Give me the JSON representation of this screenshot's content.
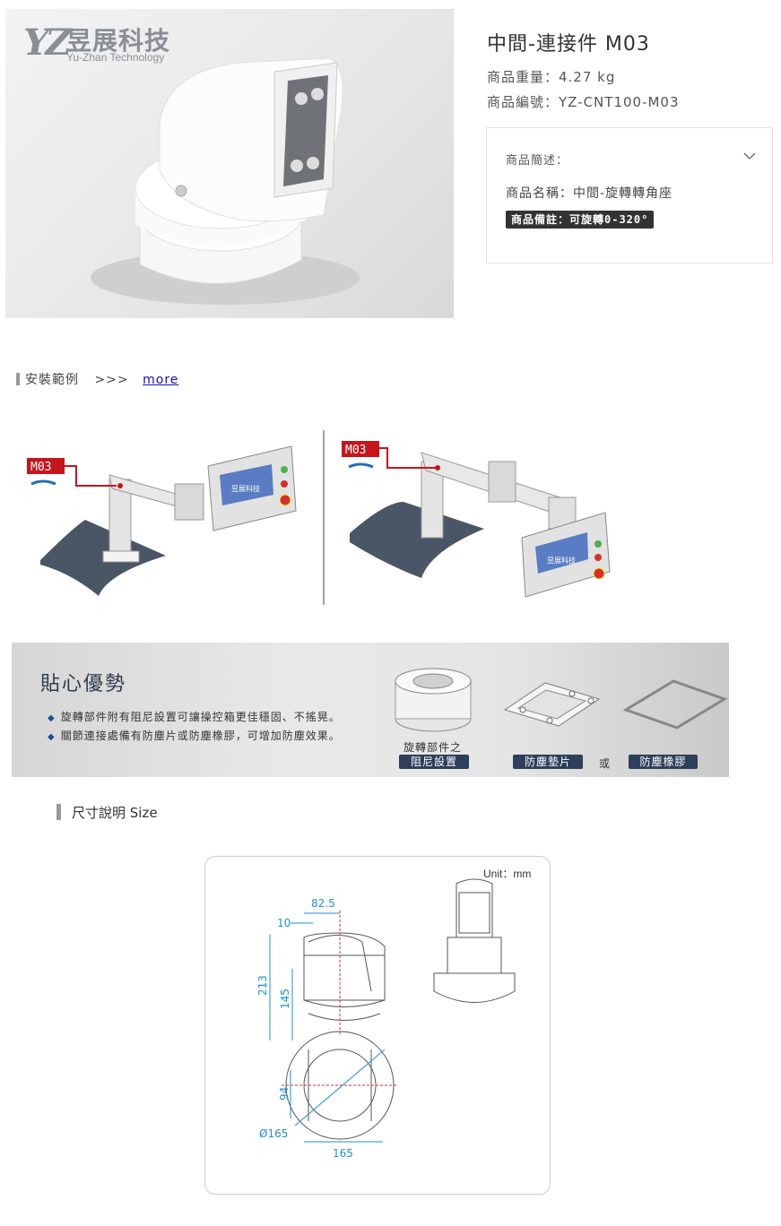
{
  "brand": {
    "mark": "YZ",
    "name_cn": "昱展科技",
    "name_en": "Yu-Zhan Technology"
  },
  "product": {
    "title": "中間-連接件 M03",
    "weight": "商品重量：4.27 kg",
    "sku": "商品編號：YZ-CNT100-M03",
    "desc_label": "商品簡述：",
    "desc_name": "商品名稱：中間-旋轉轉角座",
    "desc_note": "商品備註：可旋轉0-320°"
  },
  "install": {
    "label": "安裝範例",
    "arrows": ">>>",
    "link": "more"
  },
  "examples": {
    "tag": "M03",
    "screen_text": "昱展科技"
  },
  "advantages": {
    "title": "貼心優勢",
    "items": [
      "旋轉部件附有阻尼設置可讓操控箱更佳穩固、不搖晃。",
      "關節連接處備有防塵片或防塵橡膠，可增加防塵效果。"
    ],
    "part1_caption": "旋轉部件之",
    "part1_tag": "阻尼設置",
    "part2_tag": "防塵墊片",
    "or": "或",
    "part3_tag": "防塵橡膠"
  },
  "size": {
    "heading": "尺寸說明 Size",
    "unit": "Unit：mm",
    "dims": {
      "d1": "82.5",
      "d2": "10",
      "d3": "213",
      "d4": "145",
      "d5": "94",
      "d6": "Ø165",
      "d7": "165"
    }
  },
  "colors": {
    "accent_red": "#c4161c",
    "dim_blue": "#1e8fd6",
    "tag_navy": "#2d3f5b"
  }
}
